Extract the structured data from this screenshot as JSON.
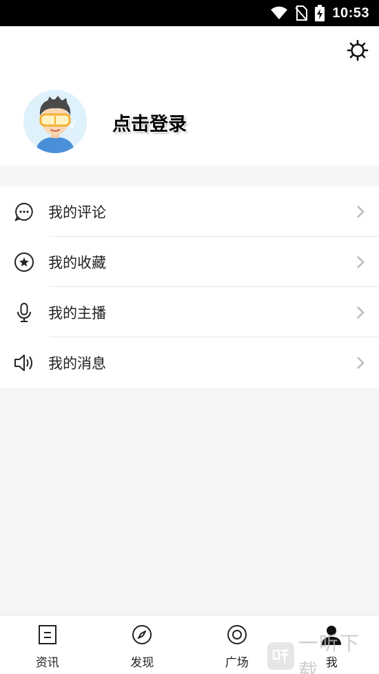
{
  "status_bar": {
    "time": "10:53",
    "icons": [
      "wifi-icon",
      "no-sim-icon",
      "battery-charging-icon"
    ]
  },
  "profile": {
    "settings_icon": "gear-icon",
    "avatar": "avatar-cartoon-boy",
    "login_label": "点击登录"
  },
  "menu": {
    "items": [
      {
        "label": "我的评论",
        "icon": "comment-icon"
      },
      {
        "label": "我的收藏",
        "icon": "star-circle-icon"
      },
      {
        "label": "我的主播",
        "icon": "microphone-icon"
      },
      {
        "label": "我的消息",
        "icon": "speaker-icon"
      }
    ]
  },
  "tabbar": {
    "tabs": [
      {
        "label": "资讯",
        "icon": "news-icon",
        "active": false
      },
      {
        "label": "发现",
        "icon": "compass-icon",
        "active": false
      },
      {
        "label": "广场",
        "icon": "target-icon",
        "active": false
      },
      {
        "label": "我",
        "icon": "person-icon",
        "active": true
      }
    ]
  },
  "watermark": {
    "text": "一听下载"
  },
  "colors": {
    "background": "#f5f5f5",
    "surface": "#ffffff",
    "text": "#222222",
    "divider": "#e6e6e6",
    "chevron": "#b8b8b8",
    "status_bar": "#000000"
  }
}
